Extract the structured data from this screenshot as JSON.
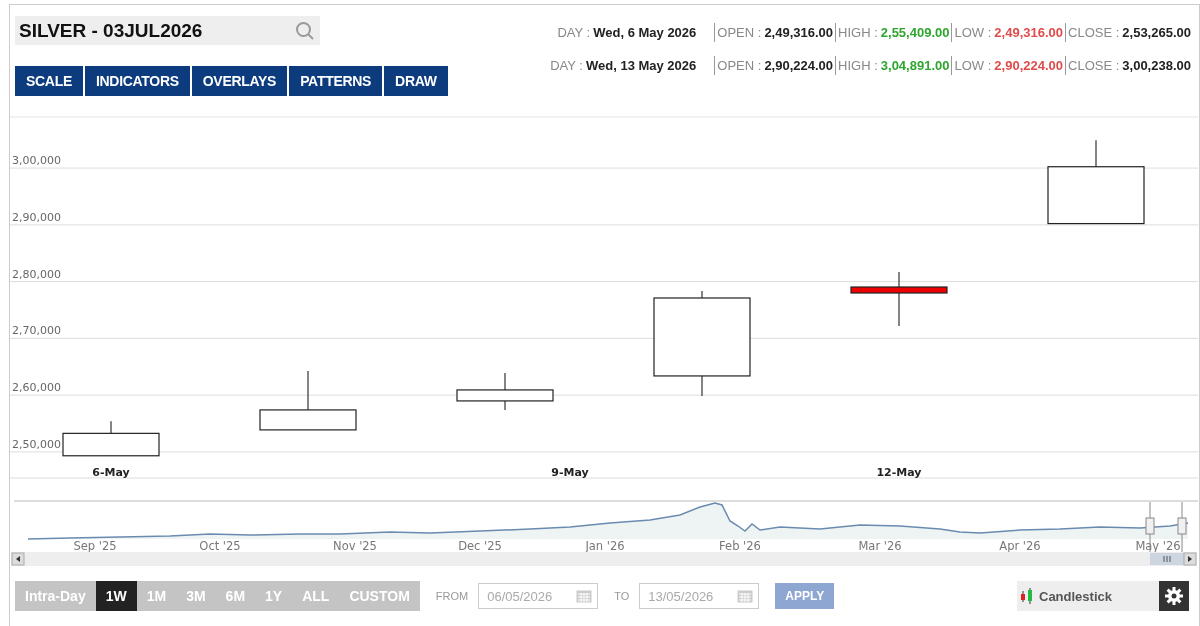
{
  "symbol": {
    "value": "SILVER - 03JUL2026"
  },
  "toolbar": [
    "SCALE",
    "INDICATORS",
    "OVERLAYS",
    "PATTERNS",
    "DRAW"
  ],
  "quotes": [
    [
      {
        "kind": "day",
        "label": "DAY :",
        "value": "Wed, 6 May 2026"
      },
      {
        "kind": "open",
        "label": "OPEN :",
        "value": "2,49,316.00"
      },
      {
        "kind": "high",
        "label": "HIGH :",
        "value": "2,55,409.00"
      },
      {
        "kind": "low",
        "label": "LOW :",
        "value": "2,49,316.00"
      },
      {
        "kind": "close",
        "label": "CLOSE :",
        "value": "2,53,265.00"
      }
    ],
    [
      {
        "kind": "day",
        "label": "DAY :",
        "value": "Wed, 13 May 2026"
      },
      {
        "kind": "open",
        "label": "OPEN :",
        "value": "2,90,224.00"
      },
      {
        "kind": "high",
        "label": "HIGH :",
        "value": "3,04,891.00"
      },
      {
        "kind": "low",
        "label": "LOW :",
        "value": "2,90,224.00"
      },
      {
        "kind": "close",
        "label": "CLOSE :",
        "value": "3,00,238.00"
      }
    ]
  ],
  "chart": {
    "y_labels": [
      "3,00,000",
      "2,90,000",
      "2,80,000",
      "2,70,000",
      "2,60,000",
      "2,50,000"
    ],
    "x_labels": [
      "6-May",
      "9-May",
      "12-May"
    ]
  },
  "navigator": {
    "months": [
      "Sep '25",
      "Oct '25",
      "Nov '25",
      "Dec '25",
      "Jan '26",
      "Feb '26",
      "Mar '26",
      "Apr '26",
      "May '26"
    ]
  },
  "periods": [
    {
      "label": "Intra-Day",
      "selected": false
    },
    {
      "label": "1W",
      "selected": true
    },
    {
      "label": "1M",
      "selected": false
    },
    {
      "label": "3M",
      "selected": false
    },
    {
      "label": "6M",
      "selected": false
    },
    {
      "label": "1Y",
      "selected": false
    },
    {
      "label": "ALL",
      "selected": false
    },
    {
      "label": "CUSTOM",
      "selected": false
    }
  ],
  "range": {
    "from_label": "FROM",
    "from": "06/05/2026",
    "to_label": "TO",
    "to": "13/05/2026",
    "apply": "APPLY"
  },
  "chart_type": {
    "value": "Candlestick"
  }
}
